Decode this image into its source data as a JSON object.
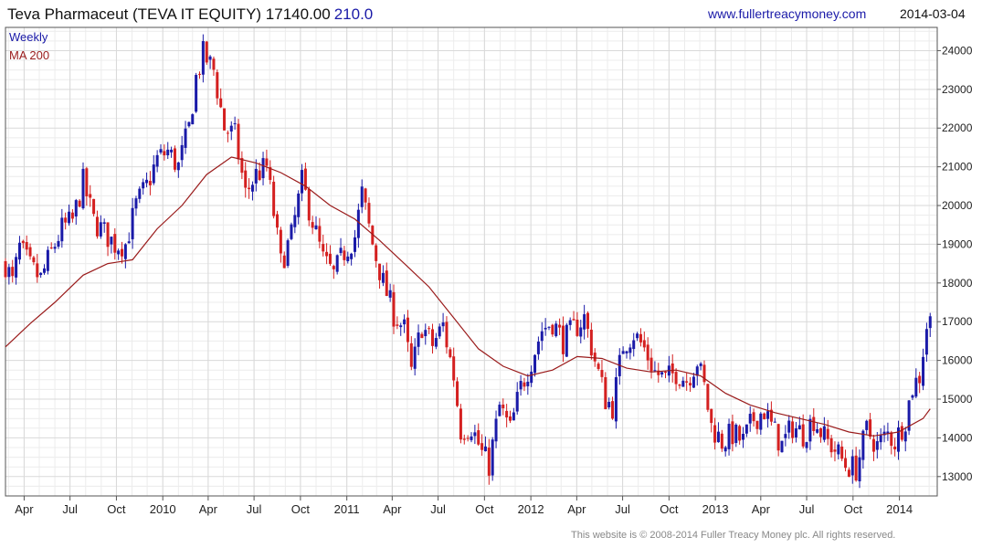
{
  "header": {
    "title": "Teva Pharmaceut (TEVA IT EQUITY) 17140.00",
    "change": "210.0",
    "website": "www.fullertreacymoney.com",
    "date": "2014-03-04"
  },
  "footer": {
    "copyright": "This website is © 2008-2014 Fuller Treacy Money plc. All rights reserved."
  },
  "colors": {
    "up": "#1a1aa8",
    "down": "#d42020",
    "ma": "#9a1b1b",
    "grid": "#d9d9d9",
    "frame": "#555555"
  },
  "chart_data": {
    "type": "candlestick",
    "interval": "Weekly",
    "title": "Teva Pharmaceut (TEVA IT EQUITY) 17140.00",
    "legend": [
      "Weekly",
      "MA 200"
    ],
    "legend_position": "top-left",
    "grid": true,
    "y_axis_position": "right",
    "ylim": [
      12500,
      24600
    ],
    "y_ticks": [
      13000,
      14000,
      15000,
      16000,
      17000,
      18000,
      19000,
      20000,
      21000,
      22000,
      23000,
      24000
    ],
    "y_tick_labels": [
      "13000",
      "14000",
      "15000",
      "16000",
      "17000",
      "18000",
      "19000",
      "20000",
      "21000",
      "22000",
      "23000",
      "24000"
    ],
    "x_ticks": [
      {
        "label": "Apr",
        "date": "2009-04-01"
      },
      {
        "label": "Jul",
        "date": "2009-07-01"
      },
      {
        "label": "Oct",
        "date": "2009-10-01"
      },
      {
        "label": "2010",
        "date": "2010-01-01"
      },
      {
        "label": "Apr",
        "date": "2010-04-01"
      },
      {
        "label": "Jul",
        "date": "2010-07-01"
      },
      {
        "label": "Oct",
        "date": "2010-10-01"
      },
      {
        "label": "2011",
        "date": "2011-01-01"
      },
      {
        "label": "Apr",
        "date": "2011-04-01"
      },
      {
        "label": "Jul",
        "date": "2011-07-01"
      },
      {
        "label": "Oct",
        "date": "2011-10-01"
      },
      {
        "label": "2012",
        "date": "2012-01-01"
      },
      {
        "label": "Apr",
        "date": "2012-04-01"
      },
      {
        "label": "Jul",
        "date": "2012-07-01"
      },
      {
        "label": "Oct",
        "date": "2012-10-01"
      },
      {
        "label": "2013",
        "date": "2013-01-01"
      },
      {
        "label": "Apr",
        "date": "2013-04-01"
      },
      {
        "label": "Jul",
        "date": "2013-07-01"
      },
      {
        "label": "Oct",
        "date": "2013-10-01"
      },
      {
        "label": "2014",
        "date": "2014-01-01"
      }
    ],
    "xlim": [
      "2009-02-23",
      "2014-03-17"
    ],
    "last_close": 17140,
    "price_path": [
      [
        "2009-02-23",
        18500
      ],
      [
        "2009-03-09",
        18000
      ],
      [
        "2009-03-23",
        18900
      ],
      [
        "2009-04-13",
        18400
      ],
      [
        "2009-05-04",
        18100
      ],
      [
        "2009-05-25",
        18800
      ],
      [
        "2009-06-15",
        19400
      ],
      [
        "2009-07-06",
        19600
      ],
      [
        "2009-07-27",
        20600
      ],
      [
        "2009-08-17",
        19600
      ],
      [
        "2009-09-07",
        19300
      ],
      [
        "2009-09-28",
        19000
      ],
      [
        "2009-10-19",
        19000
      ],
      [
        "2009-11-09",
        20000
      ],
      [
        "2009-11-30",
        20500
      ],
      [
        "2009-12-21",
        21200
      ],
      [
        "2010-01-11",
        21400
      ],
      [
        "2010-02-01",
        21000
      ],
      [
        "2010-02-22",
        22000
      ],
      [
        "2010-03-08",
        23300
      ],
      [
        "2010-03-22",
        23900
      ],
      [
        "2010-04-12",
        23500
      ],
      [
        "2010-05-03",
        22000
      ],
      [
        "2010-05-24",
        21800
      ],
      [
        "2010-06-14",
        20300
      ],
      [
        "2010-07-05",
        20800
      ],
      [
        "2010-07-26",
        21000
      ],
      [
        "2010-08-09",
        19800
      ],
      [
        "2010-08-23",
        18500
      ],
      [
        "2010-09-13",
        19200
      ],
      [
        "2010-10-04",
        20600
      ],
      [
        "2010-10-25",
        19600
      ],
      [
        "2010-11-15",
        18600
      ],
      [
        "2010-12-06",
        18200
      ],
      [
        "2010-12-27",
        18800
      ],
      [
        "2011-01-17",
        19200
      ],
      [
        "2011-01-31",
        20300
      ],
      [
        "2011-02-21",
        19000
      ],
      [
        "2011-03-14",
        18000
      ],
      [
        "2011-04-04",
        17200
      ],
      [
        "2011-04-25",
        16800
      ],
      [
        "2011-05-09",
        15700
      ],
      [
        "2011-05-30",
        16900
      ],
      [
        "2011-06-20",
        16400
      ],
      [
        "2011-07-11",
        16900
      ],
      [
        "2011-08-01",
        15600
      ],
      [
        "2011-08-15",
        14200
      ],
      [
        "2011-09-05",
        14300
      ],
      [
        "2011-09-26",
        13600
      ],
      [
        "2011-10-10",
        13300
      ],
      [
        "2011-10-31",
        14800
      ],
      [
        "2011-11-21",
        14200
      ],
      [
        "2011-12-12",
        15300
      ],
      [
        "2012-01-02",
        16000
      ],
      [
        "2012-01-23",
        16800
      ],
      [
        "2012-02-13",
        17000
      ],
      [
        "2012-03-05",
        16500
      ],
      [
        "2012-03-26",
        16800
      ],
      [
        "2012-04-16",
        17100
      ],
      [
        "2012-05-07",
        16000
      ],
      [
        "2012-05-28",
        15000
      ],
      [
        "2012-06-11",
        14800
      ],
      [
        "2012-07-02",
        16400
      ],
      [
        "2012-07-23",
        16700
      ],
      [
        "2012-08-13",
        16300
      ],
      [
        "2012-09-03",
        15700
      ],
      [
        "2012-09-24",
        15500
      ],
      [
        "2012-10-15",
        15700
      ],
      [
        "2012-11-05",
        15500
      ],
      [
        "2012-11-26",
        16000
      ],
      [
        "2012-12-10",
        15300
      ],
      [
        "2012-12-24",
        14300
      ],
      [
        "2013-01-14",
        13900
      ],
      [
        "2013-02-04",
        14100
      ],
      [
        "2013-02-25",
        13900
      ],
      [
        "2013-03-18",
        14500
      ],
      [
        "2013-04-08",
        14700
      ],
      [
        "2013-04-22",
        14300
      ],
      [
        "2013-05-13",
        13800
      ],
      [
        "2013-06-03",
        14300
      ],
      [
        "2013-06-24",
        14100
      ],
      [
        "2013-07-15",
        14500
      ],
      [
        "2013-08-05",
        14000
      ],
      [
        "2013-08-26",
        13700
      ],
      [
        "2013-09-16",
        13300
      ],
      [
        "2013-10-07",
        13200
      ],
      [
        "2013-10-28",
        14200
      ],
      [
        "2013-11-18",
        13800
      ],
      [
        "2013-12-09",
        14100
      ],
      [
        "2013-12-23",
        13900
      ],
      [
        "2014-01-13",
        14500
      ],
      [
        "2014-01-27",
        15300
      ],
      [
        "2014-02-10",
        15600
      ],
      [
        "2014-02-24",
        16900
      ],
      [
        "2014-03-03",
        17140
      ]
    ],
    "series": [
      {
        "name": "MA 200",
        "points": [
          [
            "2009-02-23",
            16350
          ],
          [
            "2009-04-13",
            16950
          ],
          [
            "2009-06-01",
            17500
          ],
          [
            "2009-07-27",
            18200
          ],
          [
            "2009-09-14",
            18500
          ],
          [
            "2009-11-02",
            18600
          ],
          [
            "2009-12-21",
            19400
          ],
          [
            "2010-02-08",
            20000
          ],
          [
            "2010-03-29",
            20800
          ],
          [
            "2010-05-17",
            21250
          ],
          [
            "2010-07-05",
            21100
          ],
          [
            "2010-08-23",
            20850
          ],
          [
            "2010-10-11",
            20500
          ],
          [
            "2010-11-29",
            20000
          ],
          [
            "2011-01-17",
            19650
          ],
          [
            "2011-03-07",
            19100
          ],
          [
            "2011-04-25",
            18500
          ],
          [
            "2011-06-13",
            17900
          ],
          [
            "2011-08-01",
            17100
          ],
          [
            "2011-09-19",
            16300
          ],
          [
            "2011-11-07",
            15850
          ],
          [
            "2011-12-26",
            15600
          ],
          [
            "2012-02-13",
            15750
          ],
          [
            "2012-04-02",
            16100
          ],
          [
            "2012-05-21",
            16050
          ],
          [
            "2012-07-09",
            15800
          ],
          [
            "2012-08-27",
            15700
          ],
          [
            "2012-10-15",
            15750
          ],
          [
            "2012-12-03",
            15600
          ],
          [
            "2013-01-21",
            15150
          ],
          [
            "2013-03-11",
            14850
          ],
          [
            "2013-04-29",
            14650
          ],
          [
            "2013-06-17",
            14500
          ],
          [
            "2013-08-05",
            14350
          ],
          [
            "2013-09-23",
            14150
          ],
          [
            "2013-11-11",
            14050
          ],
          [
            "2013-12-30",
            14150
          ],
          [
            "2014-02-17",
            14500
          ],
          [
            "2014-03-03",
            14750
          ]
        ]
      }
    ]
  }
}
